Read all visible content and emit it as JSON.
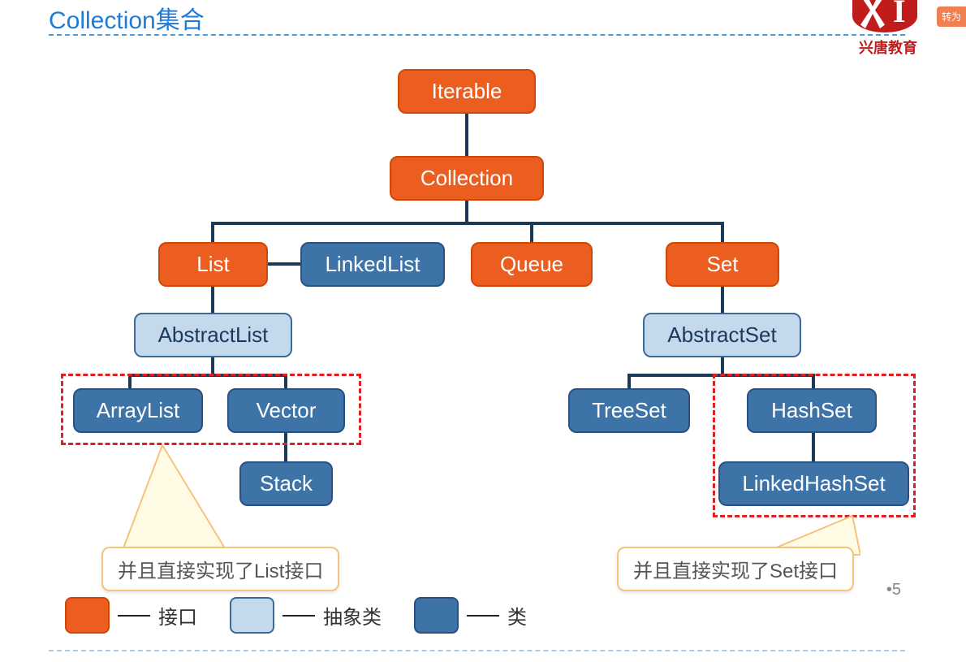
{
  "title": "Collection集合",
  "brand": "兴唐教育",
  "badge": "转为",
  "page_number": "•5",
  "nodes": {
    "iterable": "Iterable",
    "collection": "Collection",
    "list": "List",
    "linkedlist": "LinkedList",
    "queue": "Queue",
    "set": "Set",
    "abstractlist": "AbstractList",
    "abstractset": "AbstractSet",
    "arraylist": "ArrayList",
    "vector": "Vector",
    "stack": "Stack",
    "treeset": "TreeSet",
    "hashset": "HashSet",
    "linkedhashset": "LinkedHashSet"
  },
  "callout_left": "并且直接实现了List接口",
  "callout_right": "并且直接实现了Set接口",
  "legend": {
    "interface": "接口",
    "abstract": "抽象类",
    "class": "类"
  }
}
